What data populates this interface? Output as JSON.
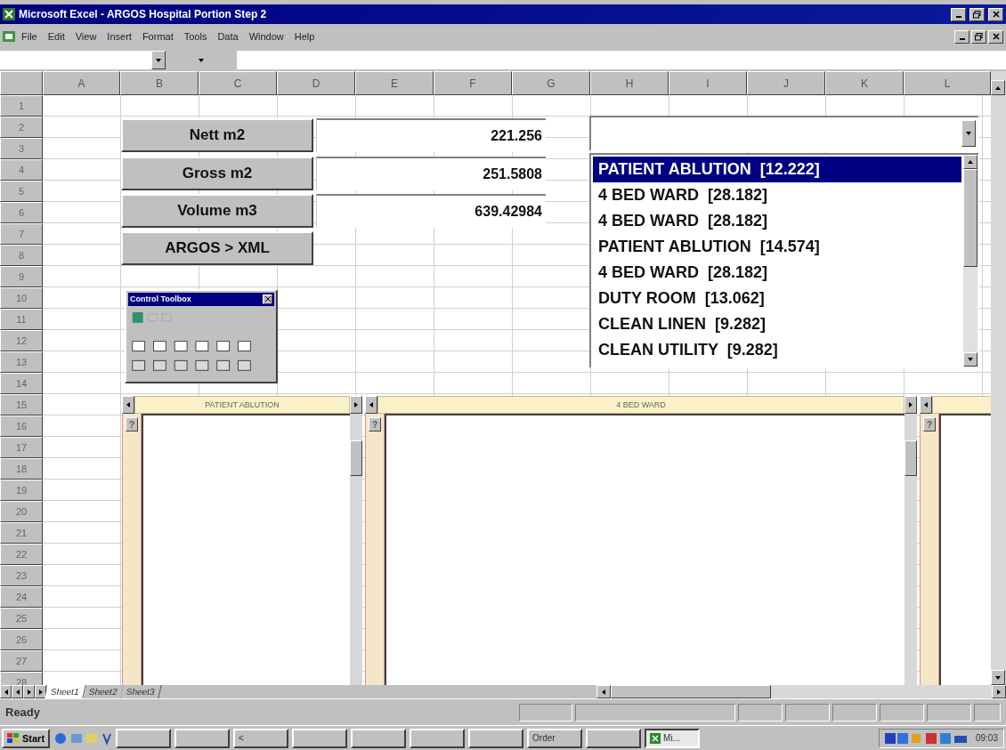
{
  "window": {
    "title": "Microsoft Excel - ARGOS Hospital Portion Step 2"
  },
  "menu": [
    "File",
    "Edit",
    "View",
    "Insert",
    "Format",
    "Tools",
    "Data",
    "Window",
    "Help"
  ],
  "columns": [
    "A",
    "B",
    "C",
    "D",
    "E",
    "F",
    "G",
    "H",
    "I",
    "J",
    "K",
    "L"
  ],
  "rows": [
    "1",
    "2",
    "3",
    "4",
    "5",
    "6",
    "7",
    "8",
    "9",
    "10",
    "11",
    "12",
    "13",
    "14",
    "15",
    "16",
    "17",
    "18",
    "19",
    "20",
    "21",
    "22",
    "23",
    "24",
    "25",
    "26",
    "27",
    "28"
  ],
  "measures": [
    {
      "label": "Nett m2",
      "value": "221.256"
    },
    {
      "label": "Gross m2",
      "value": "251.5808"
    },
    {
      "label": "Volume m3",
      "value": "639.42984"
    },
    {
      "label": "ARGOS > XML"
    }
  ],
  "room_list": [
    {
      "label": "PATIENT ABLUTION  [12.222]",
      "selected": true
    },
    {
      "label": "4 BED WARD  [28.182]",
      "selected": false
    },
    {
      "label": "4 BED WARD  [28.182]",
      "selected": false
    },
    {
      "label": "PATIENT ABLUTION  [14.574]",
      "selected": false
    },
    {
      "label": "4 BED WARD  [28.182]",
      "selected": false
    },
    {
      "label": "DUTY ROOM  [13.062]",
      "selected": false
    },
    {
      "label": "CLEAN LINEN  [9.282]",
      "selected": false
    },
    {
      "label": "CLEAN UTILITY  [9.282]",
      "selected": false
    }
  ],
  "toolbox": {
    "title": "Control Toolbox"
  },
  "panels": [
    {
      "caption": "PATIENT ABLUTION",
      "label": "?"
    },
    {
      "caption": "4 BED WARD",
      "label": "?"
    },
    {
      "label": "?"
    }
  ],
  "sheet_tabs": [
    {
      "label": "Sheet1",
      "selected": true
    },
    {
      "label": "Sheet2",
      "selected": false
    },
    {
      "label": "Sheet3",
      "selected": false
    }
  ],
  "status": "Ready",
  "taskbar": {
    "start": "Start",
    "clock": "09:03",
    "buttons": [
      {
        "kind": "blank",
        "selected": false
      },
      {
        "kind": "blank",
        "selected": false
      },
      {
        "kind": "text",
        "label": "<",
        "selected": false
      },
      {
        "kind": "blank",
        "selected": false
      },
      {
        "kind": "blank",
        "selected": false
      },
      {
        "kind": "blank",
        "selected": false
      },
      {
        "kind": "blank",
        "selected": false
      },
      {
        "kind": "text",
        "label": "Order",
        "selected": false
      },
      {
        "kind": "blank",
        "selected": false
      },
      {
        "kind": "app",
        "label": "Mi...",
        "selected": true
      }
    ]
  }
}
